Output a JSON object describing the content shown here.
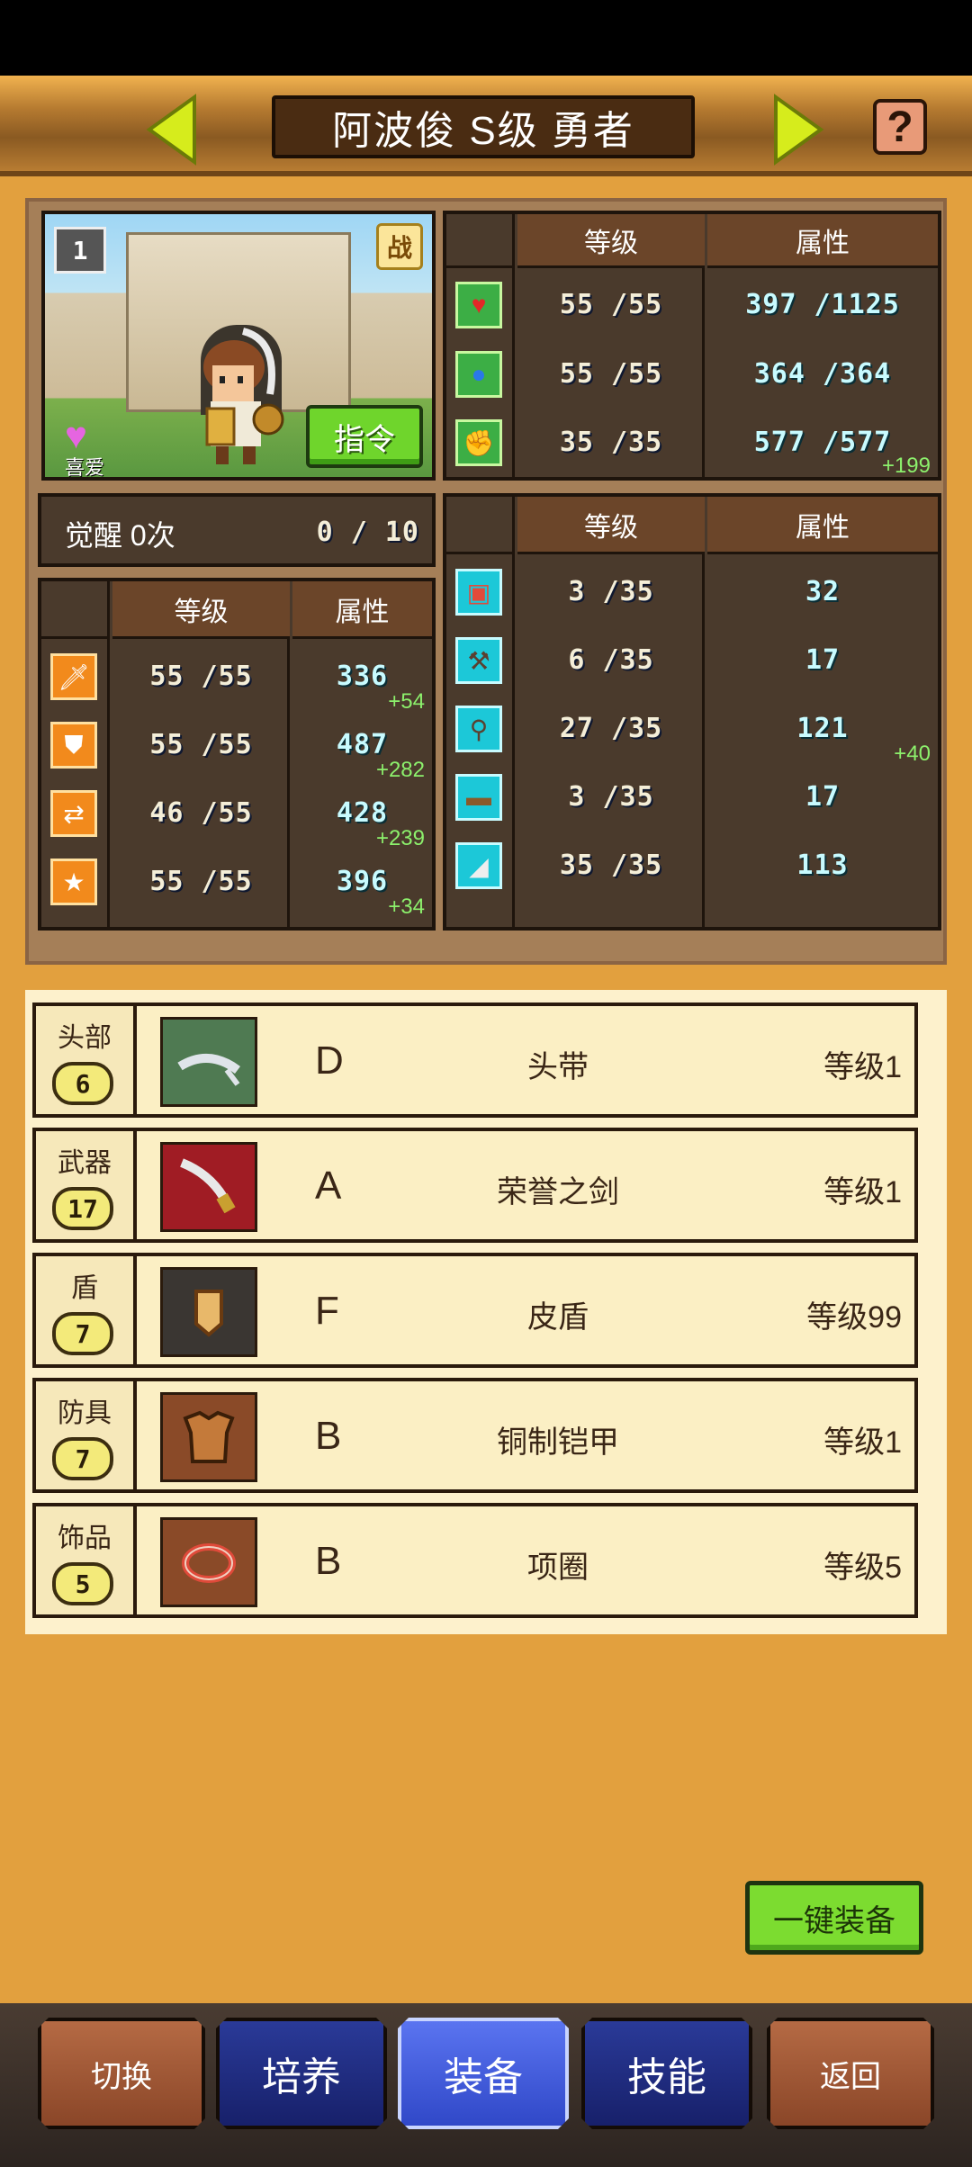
{
  "header": {
    "title": "阿波俊 S级 勇者"
  },
  "portrait": {
    "rank_badge": "1",
    "battle_badge": "战",
    "favorite_label": "喜爱",
    "command_label": "指令"
  },
  "top_stats": {
    "headers": [
      "等级",
      "属性"
    ],
    "rows": [
      {
        "icon": "heart-icon",
        "level": "55 /55",
        "value": "397 /1125",
        "bonus": ""
      },
      {
        "icon": "potion-icon",
        "level": "55 /55",
        "value": "364 /364",
        "bonus": ""
      },
      {
        "icon": "muscle-icon",
        "level": "35 /35",
        "value": "577 /577",
        "bonus": "+199"
      }
    ]
  },
  "awaken": {
    "label": "觉醒 0次",
    "progress": "0 /  10"
  },
  "left_stats": {
    "headers": [
      "等级",
      "属性"
    ],
    "rows": [
      {
        "icon": "sword-icon",
        "level": "55 /55",
        "value": "336",
        "bonus": "+54"
      },
      {
        "icon": "shield-icon",
        "level": "55 /55",
        "value": "487",
        "bonus": "+282"
      },
      {
        "icon": "speed-icon",
        "level": "46 /55",
        "value": "428",
        "bonus": "+239"
      },
      {
        "icon": "star-icon",
        "level": "55 /55",
        "value": "396",
        "bonus": "+34"
      }
    ]
  },
  "right_stats": {
    "headers": [
      "等级",
      "属性"
    ],
    "rows": [
      {
        "icon": "book-icon",
        "level": "3 /35",
        "value": "32",
        "bonus": ""
      },
      {
        "icon": "hammer-icon",
        "level": "6 /35",
        "value": "17",
        "bonus": ""
      },
      {
        "icon": "shovel-icon",
        "level": "27 /35",
        "value": "121",
        "bonus": "+40"
      },
      {
        "icon": "chest-icon",
        "level": "3 /35",
        "value": "17",
        "bonus": ""
      },
      {
        "icon": "axe-icon",
        "level": "35 /35",
        "value": "113",
        "bonus": ""
      }
    ]
  },
  "equipment": [
    {
      "slot": "头部",
      "slot_level": "6",
      "rank": "D",
      "name": "头带",
      "level": "等级1",
      "icon": "headband-icon",
      "color": "#4f7a52"
    },
    {
      "slot": "武器",
      "slot_level": "17",
      "rank": "A",
      "name": "荣誉之剑",
      "level": "等级1",
      "icon": "honor-sword-icon",
      "color": "#a01c24"
    },
    {
      "slot": "盾",
      "slot_level": "7",
      "rank": "F",
      "name": "皮盾",
      "level": "等级99",
      "icon": "leather-shield-icon",
      "color": "#3a3632"
    },
    {
      "slot": "防具",
      "slot_level": "7",
      "rank": "B",
      "name": "铜制铠甲",
      "level": "等级1",
      "icon": "bronze-armor-icon",
      "color": "#8a4a28"
    },
    {
      "slot": "饰品",
      "slot_level": "5",
      "rank": "B",
      "name": "项圈",
      "level": "等级5",
      "icon": "collar-icon",
      "color": "#8a4a28"
    }
  ],
  "auto_equip_label": "一键装备",
  "nav": [
    {
      "label": "切换",
      "style": "brown"
    },
    {
      "label": "培养",
      "style": "blue"
    },
    {
      "label": "装备",
      "style": "active"
    },
    {
      "label": "技能",
      "style": "blue"
    },
    {
      "label": "返回",
      "style": "brown"
    }
  ]
}
